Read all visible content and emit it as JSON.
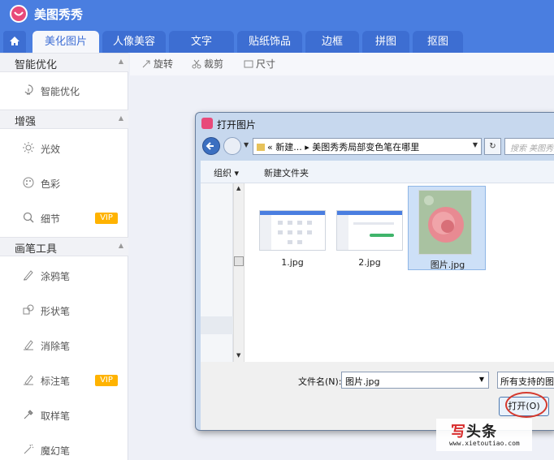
{
  "app": {
    "title": "美图秀秀"
  },
  "tabs": [
    {
      "label": "美化图片",
      "active": true
    },
    {
      "label": "人像美容"
    },
    {
      "label": "文字"
    },
    {
      "label": "贴纸饰品"
    },
    {
      "label": "边框"
    },
    {
      "label": "拼图"
    },
    {
      "label": "抠图"
    }
  ],
  "sidebar": {
    "sections": [
      {
        "label": "智能优化",
        "items": [
          {
            "label": "智能优化",
            "icon": "smart-optimize-icon"
          }
        ]
      },
      {
        "label": "增强",
        "items": [
          {
            "label": "光效",
            "icon": "light-icon"
          },
          {
            "label": "色彩",
            "icon": "palette-icon"
          },
          {
            "label": "细节",
            "icon": "detail-magnifier-icon",
            "badge": "VIP"
          }
        ]
      },
      {
        "label": "画笔工具",
        "items": [
          {
            "label": "涂鸦笔",
            "icon": "doodle-brush-icon"
          },
          {
            "label": "形状笔",
            "icon": "shape-pen-icon"
          },
          {
            "label": "消除笔",
            "icon": "eraser-pen-icon"
          },
          {
            "label": "标注笔",
            "icon": "annotate-pen-icon",
            "badge": "VIP"
          },
          {
            "label": "取样笔",
            "icon": "eyedropper-icon"
          },
          {
            "label": "魔幻笔",
            "icon": "magic-pen-icon"
          }
        ]
      }
    ]
  },
  "toolbar": {
    "rotate": "旋转",
    "crop": "裁剪",
    "size": "尺寸"
  },
  "dialog": {
    "title": "打开图片",
    "address": {
      "prefix": "«",
      "part1": "新建...",
      "sep": "▸",
      "part2": "美图秀秀局部变色笔在哪里"
    },
    "search_placeholder": "搜索 美图秀秀...",
    "commands": {
      "organize": "组织 ▾",
      "new_folder": "新建文件夹"
    },
    "files": [
      {
        "name": "1.jpg",
        "selected": false
      },
      {
        "name": "2.jpg",
        "selected": false
      },
      {
        "name": "图片.jpg",
        "selected": true
      }
    ],
    "filename_label": "文件名(N):",
    "filename_value": "图片.jpg",
    "filetype_value": "所有支持的图片",
    "open_button": "打开(O)"
  },
  "watermark": {
    "logo_red": "写",
    "logo_rest": "头条",
    "url": "www.xietoutiao.com"
  },
  "colors": {
    "brand_blue": "#4a7ee0",
    "vip_badge": "#ffb300",
    "highlight_ring": "#d43a2f"
  }
}
